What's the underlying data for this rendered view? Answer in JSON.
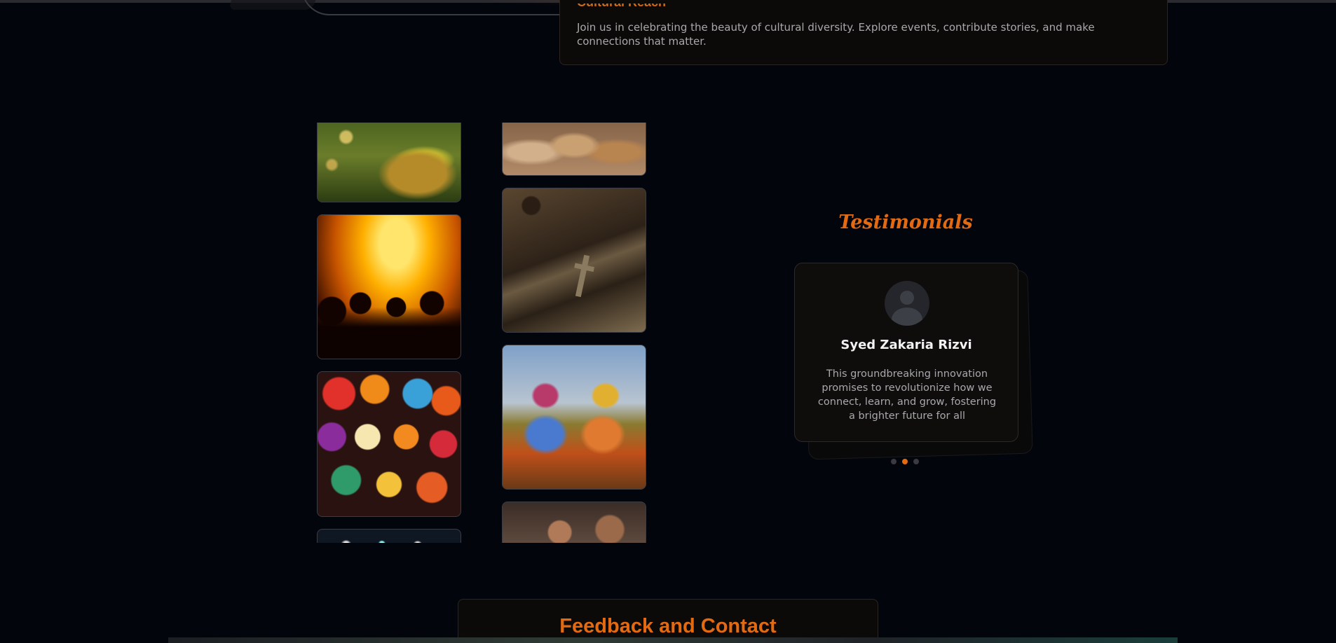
{
  "info": {
    "title": "Cultural Reach",
    "text": "Join us in celebrating the beauty of cultural diversity. Explore events, contribute stories, and make connections that matter."
  },
  "gallery": {
    "images": [
      "candles-image",
      "concert-image",
      "lanterns-image",
      "lights-image",
      "food-image",
      "books-image",
      "dancers-image",
      "people-image"
    ]
  },
  "testimonials": {
    "title": "Testimonials",
    "name": "Syed Zakaria Rizvi",
    "quote": "This groundbreaking innovation promises to revolutionize how we connect, learn, and grow, fostering a brighter future for all",
    "active_index": 1,
    "slide_count": 3
  },
  "feedback": {
    "title": "Feedback and Contact"
  },
  "colors": {
    "accent": "#e46a12",
    "background": "#03050d",
    "card": "#0e0d0c"
  }
}
